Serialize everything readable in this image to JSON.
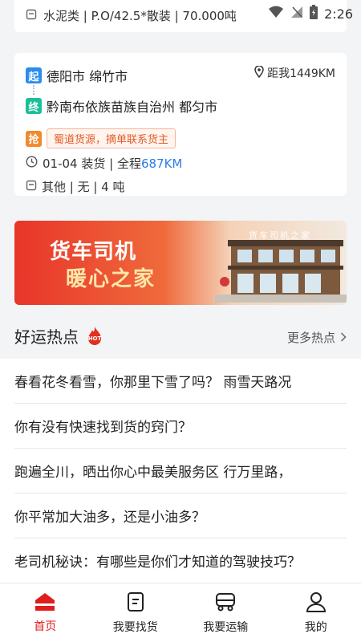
{
  "status": {
    "time": "2:26"
  },
  "top_card": {
    "cargo": "水泥类 | P.O/42.5*散装 | 70.000吨"
  },
  "order": {
    "start_tag": "起",
    "end_tag": "终",
    "origin": "德阳市 绵竹市",
    "destination": "黔南布依族苗族自治州 都匀市",
    "distance": "距我1449KM",
    "grab_tag": "抢",
    "notice": "蜀道货源，摘单联系货主",
    "load_date": "01-04 装货 | 全程",
    "total_km": "687KM",
    "cargo": "其他 | 无 | 4 吨"
  },
  "banner": {
    "line1": "货车司机",
    "line2": "暖心之家",
    "sign": "货车司机之家"
  },
  "hot": {
    "title": "好运热点",
    "badge": "HOT",
    "more": "更多热点",
    "items": [
      "春看花冬看雪，你那里下雪了吗？ 雨雪天路况",
      "你有没有快速找到货的窍门？",
      "跑遍全川，晒出你心中最美服务区 行万里路，",
      "你平常加大油多，还是小油多？",
      "老司机秘诀：有哪些是你们才知道的驾驶技巧？"
    ]
  },
  "tabs": [
    {
      "label": "首页",
      "icon": "home-icon",
      "active": true
    },
    {
      "label": "我要找货",
      "icon": "document-icon",
      "active": false
    },
    {
      "label": "我要运输",
      "icon": "truck-icon",
      "active": false
    },
    {
      "label": "我的",
      "icon": "user-icon",
      "active": false
    }
  ],
  "colors": {
    "accent": "#e01c1c",
    "km": "#2b7de9",
    "start": "#2b8cf0",
    "end": "#1bbf9a",
    "grab": "#f08a2b"
  }
}
